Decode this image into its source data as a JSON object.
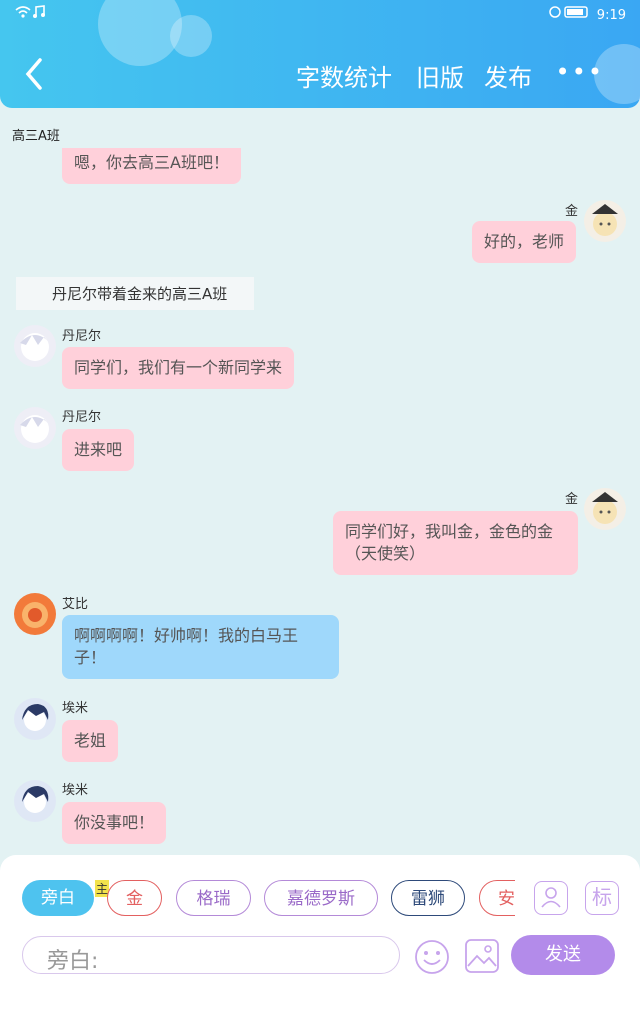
{
  "status": {
    "left_icons": "wifi music",
    "battery": "battery-icon",
    "time": "9:19"
  },
  "header": {
    "back_icon": "back-icon",
    "word_count": "字数统计",
    "old_version": "旧版",
    "publish": "发布",
    "more": "•••"
  },
  "room": "高三A班",
  "messages": {
    "m0_text": "嗯，你去高三A班吧！",
    "m1_name": "金",
    "m1_text": "好的，老师",
    "narration": "丹尼尔带着金来的高三A班",
    "m2_name": "丹尼尔",
    "m2_text": "同学们，我们有一个新同学来",
    "m3_name": "丹尼尔",
    "m3_text": "进来吧",
    "m4_name": "金",
    "m4_line1": "同学们好，我叫金，金色的金",
    "m4_line2": "（天使笑）",
    "m5_name": "艾比",
    "m5_line1": "啊啊啊啊！好帅啊！我的白马王",
    "m5_line2": "子！",
    "m6_name": "埃米",
    "m6_text": "老姐",
    "m7_name": "埃米",
    "m7_text": "你没事吧！"
  },
  "tags": {
    "narrator": "旁白",
    "main_badge": "主",
    "jin": "金",
    "gerui": "格瑞",
    "jiadeluosi": "嘉德罗斯",
    "leishi": "雷狮",
    "an": "安",
    "label_icon_text": "标"
  },
  "composer": {
    "placeholder": "旁白:",
    "send": "发送"
  },
  "colors": {
    "header": "#3aa7f3",
    "pink_bubble": "#ffd0da",
    "blue_bubble": "#9fd8fb",
    "send": "#b38bea"
  }
}
